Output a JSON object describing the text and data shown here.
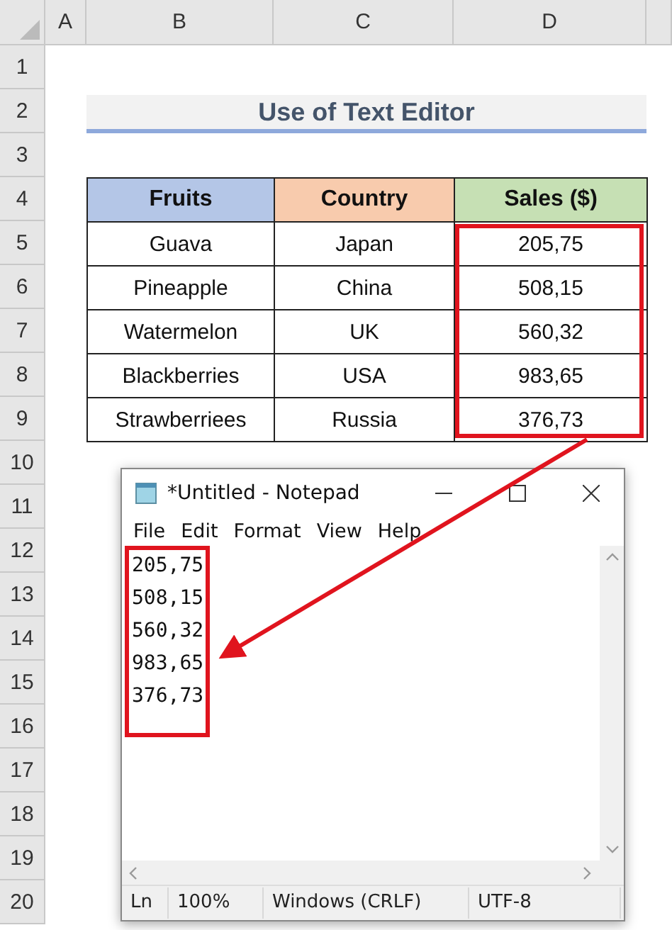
{
  "column_headers": [
    "A",
    "B",
    "C",
    "D"
  ],
  "row_numbers": [
    "1",
    "2",
    "3",
    "4",
    "5",
    "6",
    "7",
    "8",
    "9",
    "10",
    "11",
    "12",
    "13",
    "14",
    "15",
    "16",
    "17",
    "18",
    "19",
    "20"
  ],
  "title": "Use of Text Editor",
  "table": {
    "columns": [
      {
        "label": "Fruits",
        "color": "#b4c6e7"
      },
      {
        "label": "Country",
        "color": "#f8cbad"
      },
      {
        "label": "Sales ($)",
        "color": "#c6e0b4"
      }
    ],
    "rows": [
      [
        "Guava",
        "Japan",
        "205,75"
      ],
      [
        "Pineapple",
        "China",
        "508,15"
      ],
      [
        "Watermelon",
        "UK",
        "560,32"
      ],
      [
        "Blackberries",
        "USA",
        "983,65"
      ],
      [
        "Strawberriees",
        "Russia",
        "376,73"
      ]
    ]
  },
  "notepad": {
    "title": "*Untitled - Notepad",
    "menu": [
      "File",
      "Edit",
      "Format",
      "View",
      "Help"
    ],
    "lines": [
      "205,75",
      "508,15",
      "560,32",
      "983,65",
      "376,73"
    ],
    "status": [
      "Ln",
      "100%",
      "Windows (CRLF)",
      "UTF-8"
    ]
  }
}
